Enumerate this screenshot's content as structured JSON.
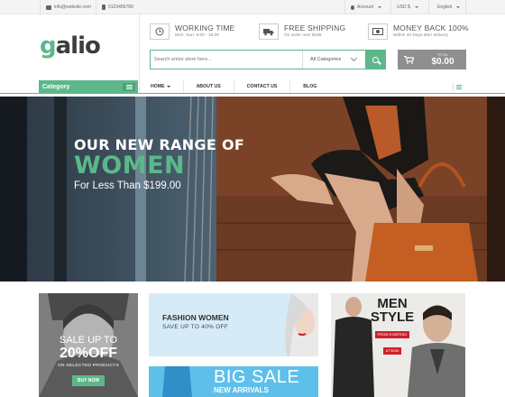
{
  "topbar": {
    "email": "info@website.com",
    "phone": "0123456789",
    "account": "Account",
    "currency": "USD $",
    "language": "English"
  },
  "logo": {
    "text_g": "g",
    "text_rest": "alio"
  },
  "features": [
    {
      "icon": "clock-icon",
      "title": "WORKING TIME",
      "sub": "Mon- Sun: 8.00 - 18.00"
    },
    {
      "icon": "truck-icon",
      "title": "FREE SHIPPING",
      "sub": "On order over $199"
    },
    {
      "icon": "money-icon",
      "title": "MONEY BACK 100%",
      "sub": "Within 30 Days after delivery"
    }
  ],
  "search": {
    "placeholder": "Search entire store here...",
    "category": "All Categories"
  },
  "cart": {
    "label": "TOTAL",
    "amount": "$0.00"
  },
  "category_bar": {
    "label": "Category"
  },
  "nav": {
    "items": [
      "HOME",
      "ABOUT US",
      "CONTACT US",
      "BLOG"
    ]
  },
  "hero": {
    "line1": "OUR NEW RANGE OF",
    "line2": "WOMEN",
    "line3": "For Less Than $199.00"
  },
  "tiles": {
    "sale": {
      "line1": "SALE UP TO",
      "line2": "20%OFF",
      "line3": "ON SELECTED PRODUCTS",
      "button": "BUY NOW"
    },
    "fashion": {
      "title": "FASHION WOMEN",
      "sub": "SAVE UP TO 40% OFF"
    },
    "big_sale": {
      "title": "BIG SALE",
      "sub": "NEW ARRIVALS"
    },
    "men": {
      "line1": "MEN",
      "line2": "STYLE",
      "line3": "FROM STARTING",
      "line4": "AT $199"
    }
  },
  "colors": {
    "accent": "#5cb88a",
    "cart_bg": "#8f8f8f"
  }
}
